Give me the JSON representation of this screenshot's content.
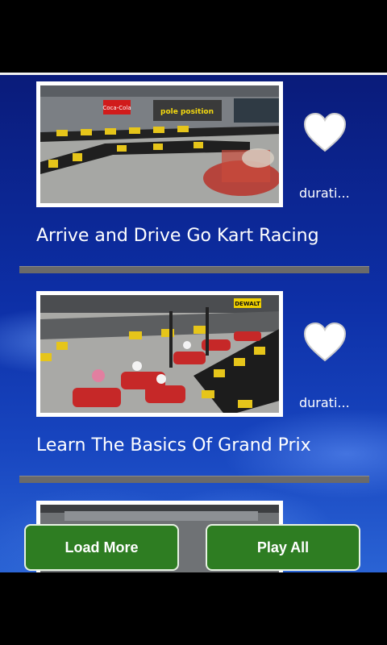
{
  "videos": [
    {
      "title": "Arrive and Drive Go Kart Racing",
      "duration": "durati...",
      "favorite_icon": "heart-icon"
    },
    {
      "title": "Learn The Basics Of Grand Prix",
      "duration": "durati...",
      "favorite_icon": "heart-icon"
    },
    {
      "title": "",
      "duration": "",
      "favorite_icon": "heart-icon"
    }
  ],
  "thumbnail_signs": {
    "first_banner": "Coca-Cola",
    "first_logo": "pole position",
    "second_sign": "DEWALT"
  },
  "buttons": {
    "load_more": "Load More",
    "play_all": "Play All"
  },
  "colors": {
    "button_green": "#2e7d22",
    "background_blue": "#0d2fa6"
  }
}
